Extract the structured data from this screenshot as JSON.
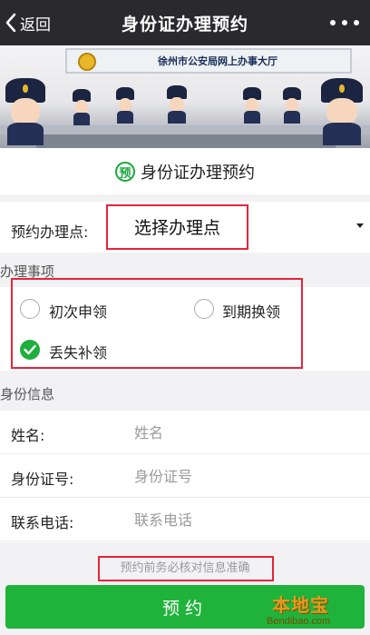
{
  "header": {
    "back_label": "返回",
    "title": "身份证办理预约"
  },
  "banner": {
    "sign_text": "徐州市公安局网上办事大厅"
  },
  "form_heading": {
    "badge": "预",
    "title": "身份证办理预约"
  },
  "location": {
    "label": "预约办理点:",
    "selected": "选择办理点"
  },
  "services": {
    "section_title": "办理事项",
    "options": [
      {
        "label": "初次申领",
        "checked": false
      },
      {
        "label": "到期换领",
        "checked": false
      },
      {
        "label": "丢失补领",
        "checked": true
      }
    ]
  },
  "identity": {
    "section_title": "身份信息",
    "fields": [
      {
        "label": "姓名:",
        "placeholder": "姓名"
      },
      {
        "label": "身份证号:",
        "placeholder": "身份证号"
      },
      {
        "label": "联系电话:",
        "placeholder": "联系电话"
      }
    ]
  },
  "notice": "预约前务必核对信息准确",
  "submit_label": "预约",
  "watermark": {
    "text": "本地宝",
    "url": "Bendibao.com"
  },
  "colors": {
    "accent_green": "#20b33b",
    "header_bg": "#2a2a2e",
    "highlight_red": "#e8233a"
  }
}
